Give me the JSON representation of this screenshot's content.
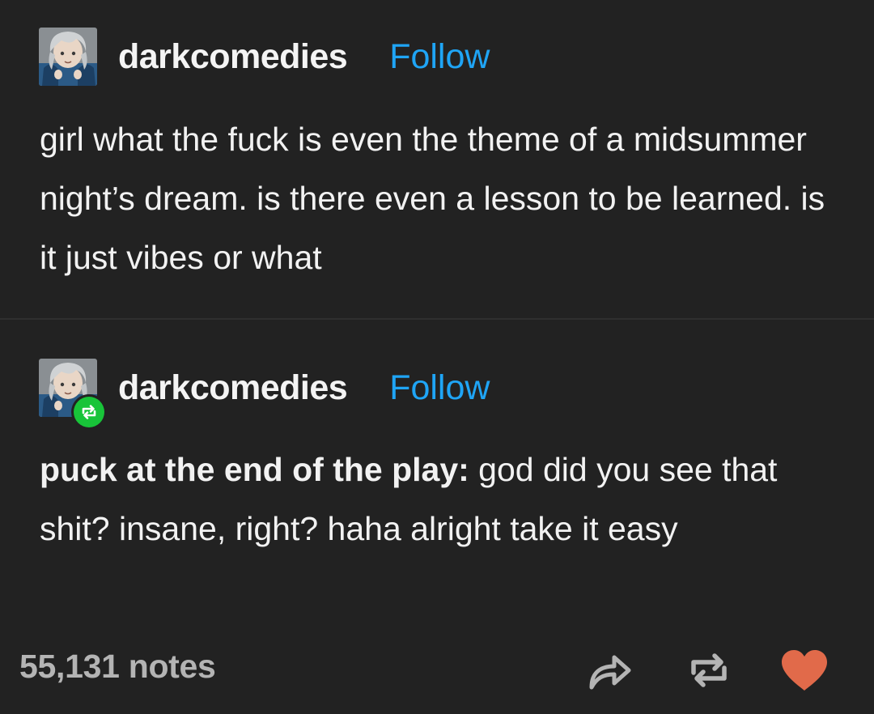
{
  "post": {
    "author": "darkcomedies",
    "follow_label": "Follow",
    "text": "girl what the fuck is even the theme of a midsummer night’s dream. is there even a lesson to be learned. is it just vibes or what"
  },
  "reblog": {
    "author": "darkcomedies",
    "follow_label": "Follow",
    "text_bold": "puck at the end of the play:",
    "text_rest": " god did you see that shit? insane, right? haha alright take it easy"
  },
  "footer": {
    "notes": "55,131 notes",
    "actions": {
      "share_icon": "share-icon",
      "reblog_icon": "reblog-icon",
      "like_icon": "heart-icon"
    }
  },
  "colors": {
    "background": "#222222",
    "text": "#f2f2f2",
    "follow": "#1fa5f6",
    "reblog_badge": "#18c439",
    "heart": "#e16a4a",
    "notes": "#b4b4b4"
  }
}
